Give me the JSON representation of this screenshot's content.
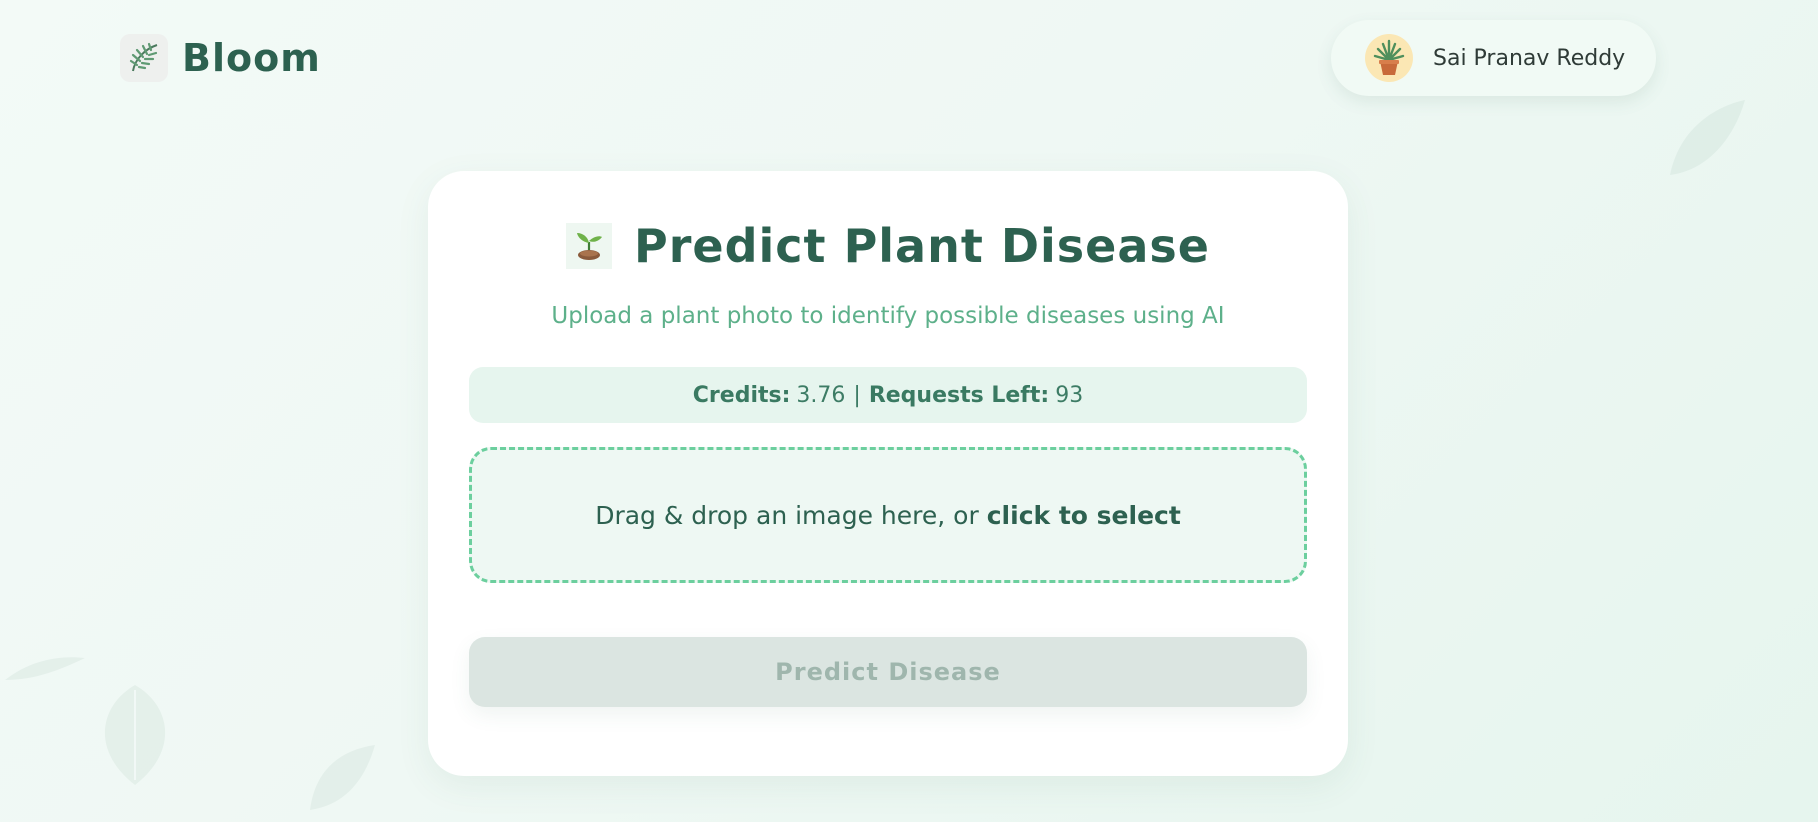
{
  "header": {
    "brand_name": "Bloom",
    "brand_icon": "leaf-icon",
    "user": {
      "name": "Sai Pranav Reddy",
      "avatar_icon": "potted-plant-icon"
    }
  },
  "card": {
    "title_icon": "seedling-icon",
    "title": "Predict Plant Disease",
    "subtitle": "Upload a plant photo to identify possible diseases using AI",
    "credits": {
      "credits_label": "Credits:",
      "credits_value": "3.76",
      "separator": "|",
      "requests_label": "Requests Left:",
      "requests_value": "93"
    },
    "dropzone": {
      "text": "Drag & drop an image here, or",
      "action_text": "click to select"
    },
    "predict_button": {
      "label": "Predict Disease",
      "disabled": true
    }
  },
  "colors": {
    "primary_text": "#2d6150",
    "subtitle": "#5db08a",
    "dropzone_border": "#6ccf9e",
    "credits_bg": "#e6f5ee",
    "button_disabled_bg": "#dbe5e1",
    "button_disabled_text": "#9fb6ad"
  }
}
